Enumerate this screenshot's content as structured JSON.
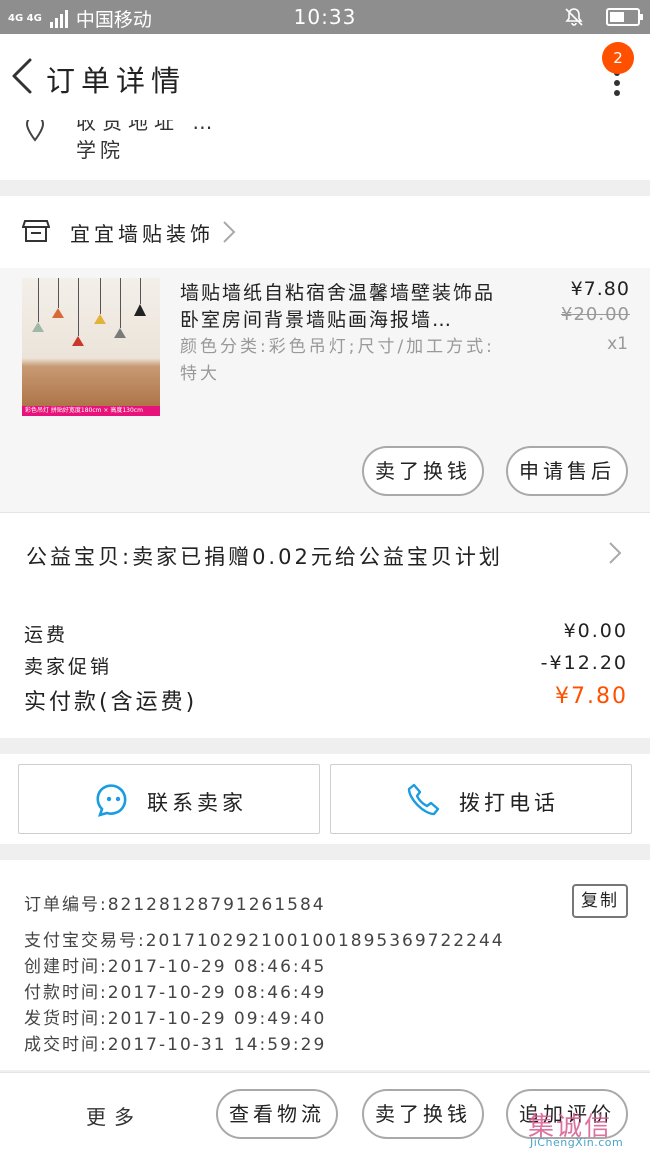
{
  "status_bar": {
    "network": "4G 4G",
    "carrier": "中国移动",
    "time": "10:33"
  },
  "header": {
    "title": "订单详情",
    "badge_count": "2"
  },
  "address": {
    "line1_partial": "收货地址 …",
    "line2": "学院"
  },
  "shop": {
    "name": "宜宜墙贴装饰"
  },
  "item": {
    "title": "墙贴墙纸自粘宿舍温馨墙壁装饰品卧室房间背景墙贴画海报墙…",
    "sku": "颜色分类:彩色吊灯;尺寸/加工方式:特大",
    "price": "¥7.80",
    "original_price": "¥20.00",
    "quantity": "x1",
    "thumb_caption": "彩色吊灯 拼贴好宽度180cm × 高度130cm",
    "buttons": {
      "swap": "卖了换钱",
      "after_sales": "申请售后"
    }
  },
  "charity": {
    "text": "公益宝贝:卖家已捐赠0.02元给公益宝贝计划"
  },
  "costs": {
    "shipping_label": "运费",
    "shipping_value": "¥0.00",
    "promo_label": "卖家促销",
    "promo_value": "-¥12.20",
    "paid_label": "实付款(含运费)",
    "paid_value": "¥7.80"
  },
  "contact": {
    "seller_label": "联系卖家",
    "phone_label": "拨打电话"
  },
  "order_info": {
    "order_no": "订单编号:82128128791261584",
    "alipay_no": "支付宝交易号:2017102921001001895369722244",
    "created": "创建时间:2017-10-29 08:46:45",
    "paid": "付款时间:2017-10-29 08:46:49",
    "shipped": "发货时间:2017-10-29 09:49:40",
    "completed": "成交时间:2017-10-31 14:59:29",
    "copy_label": "复制"
  },
  "bottom_bar": {
    "more": "更多",
    "logistics": "查看物流",
    "swap": "卖了换钱",
    "review": "追加评价"
  },
  "watermark": {
    "logo": "集诚信",
    "url": "JiChengXin.com"
  },
  "colors": {
    "accent": "#ff5000",
    "status_bar": "#8e8e8e",
    "contact_icon": "#1a9de0"
  }
}
